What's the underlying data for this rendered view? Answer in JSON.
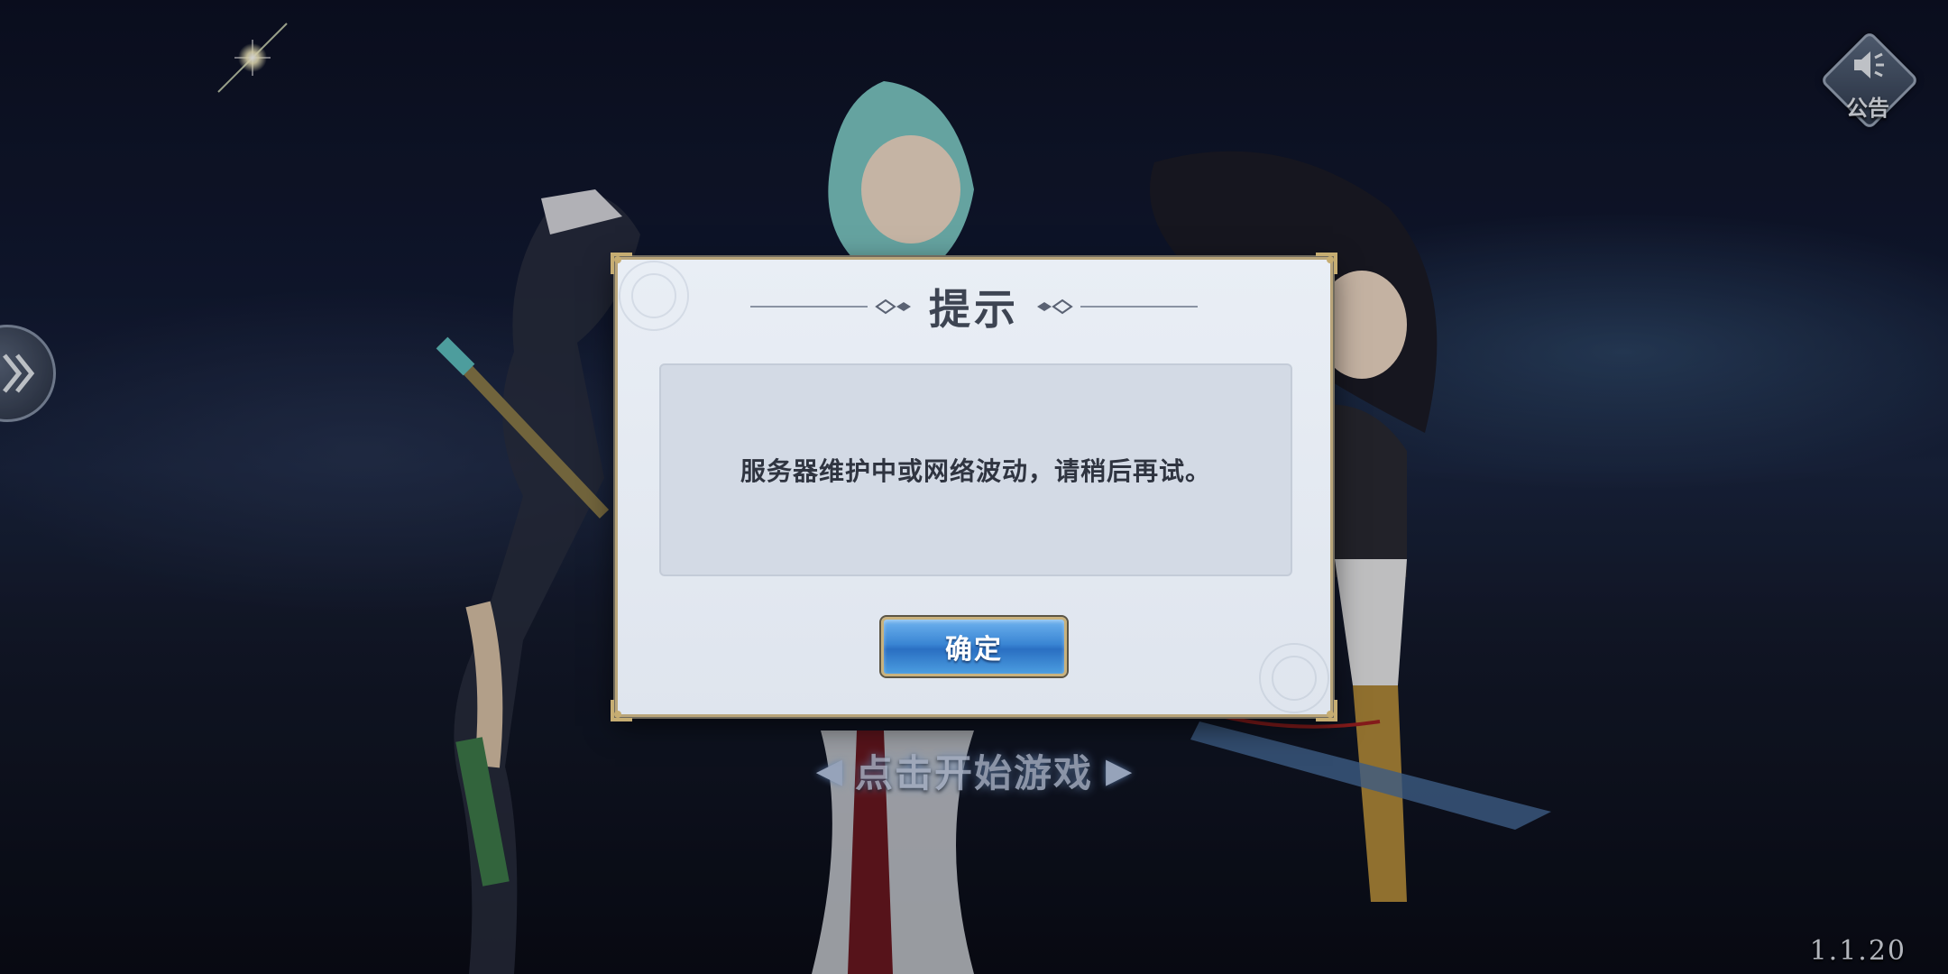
{
  "background": {
    "colors": {
      "sky_top": "#0d1124",
      "sky_mid": "#1a2540",
      "ground": "#0a0c16"
    }
  },
  "top_right": {
    "announce_label": "公告",
    "announce_icon": "speaker-icon"
  },
  "side_handle": {
    "icon": "double-chevron-right-icon"
  },
  "start": {
    "label": "点击开始游戏",
    "left_arrow": "◀",
    "right_arrow": "▶"
  },
  "version": "1.1.20",
  "dialog": {
    "title": "提示",
    "message": "服务器维护中或网络波动，请稍后再试。",
    "confirm_label": "确定",
    "colors": {
      "border_gold": "#b9a57a",
      "button_blue": "#3a86d4",
      "panel": "#e9eef5"
    }
  }
}
